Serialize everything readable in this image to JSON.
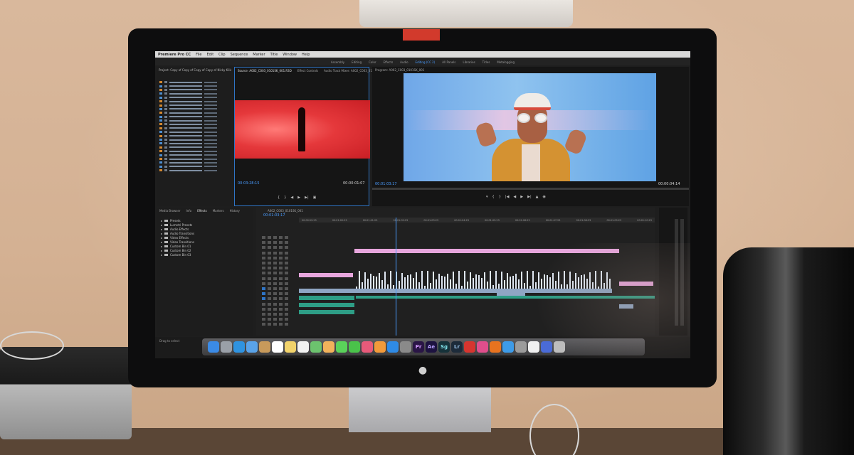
{
  "menubar": {
    "items": [
      "Premiere Pro CC",
      "File",
      "Edit",
      "Clip",
      "Sequence",
      "Marker",
      "Title",
      "Window",
      "Help"
    ]
  },
  "workspaces": {
    "items": [
      "Assembly",
      "Editing",
      "Color",
      "Effects",
      "Audio",
      "Editing (CC 2)",
      "All Panels",
      "Libraries",
      "Titles",
      "Metalogging"
    ],
    "active_index": 5
  },
  "project_panel": {
    "title": "Project: Copy of Copy of Copy of Copy of Nicky Kilian",
    "clip_count": 24
  },
  "source_panel": {
    "tabs": [
      "Source: A002_C003_0101SK_001.R3D",
      "Effect Controls",
      "Audio Track Mixer: A002_C003_0101SK_001"
    ],
    "timecode_in": "00:03:28:15",
    "timecode_out": "00:00:01:07"
  },
  "program_panel": {
    "tab": "Program: A002_C003_0101SK_001",
    "timecode_in": "00:01:03:17",
    "timecode_out": "00:00:04:14"
  },
  "effects_panel": {
    "tabs": [
      "Media Browser",
      "Info",
      "Effects",
      "Markers",
      "History"
    ],
    "items": [
      "Presets",
      "Lumetri Presets",
      "Audio Effects",
      "Audio Transitions",
      "Video Effects",
      "Video Transitions",
      "Custom Bin 01",
      "Custom Bin 02",
      "Custom Bin 03"
    ]
  },
  "timeline_panel": {
    "sequence_tab": "A002_C003_0101SK_001",
    "timecode": "00:01:03:17",
    "ruler_labels": [
      "00:00:59:23",
      "00:01:00:23",
      "00:01:01:23",
      "00:01:02:23",
      "00:01:03:23",
      "00:01:04:23",
      "00:01:05:23",
      "00:01:06:23",
      "00:01:07:23",
      "00:01:08:23",
      "00:01:09:23",
      "00:01:10:23"
    ]
  },
  "status": {
    "text": "Drag to select"
  },
  "dock": {
    "icons": [
      {
        "name": "finder-icon",
        "color": "#3b8be6",
        "glyph": ""
      },
      {
        "name": "launchpad-icon",
        "color": "#9aa0a8",
        "glyph": ""
      },
      {
        "name": "safari-icon",
        "color": "#2f93e0",
        "glyph": ""
      },
      {
        "name": "mail-icon",
        "color": "#5aa3e8",
        "glyph": ""
      },
      {
        "name": "contacts-icon",
        "color": "#c89a5b",
        "glyph": ""
      },
      {
        "name": "calendar-icon",
        "color": "#ffffff",
        "glyph": ""
      },
      {
        "name": "notes-icon",
        "color": "#f2d36b",
        "glyph": ""
      },
      {
        "name": "reminders-icon",
        "color": "#f2f2f2",
        "glyph": ""
      },
      {
        "name": "maps-icon",
        "color": "#6cc26e",
        "glyph": ""
      },
      {
        "name": "photos-icon",
        "color": "#f2b25b",
        "glyph": ""
      },
      {
        "name": "messages-icon",
        "color": "#5ad25a",
        "glyph": ""
      },
      {
        "name": "facetime-icon",
        "color": "#4ac34a",
        "glyph": ""
      },
      {
        "name": "music-icon",
        "color": "#e85a7a",
        "glyph": ""
      },
      {
        "name": "ibooks-icon",
        "color": "#f29a3a",
        "glyph": ""
      },
      {
        "name": "app-store-icon",
        "color": "#2f8be6",
        "glyph": ""
      },
      {
        "name": "preferences-icon",
        "color": "#8a8a8a",
        "glyph": ""
      },
      {
        "name": "premiere-icon",
        "color": "#2a1546",
        "glyph": "Pr"
      },
      {
        "name": "after-effects-icon",
        "color": "#1d1240",
        "glyph": "Ae"
      },
      {
        "name": "speedgrade-icon",
        "color": "#16323a",
        "glyph": "Sg"
      },
      {
        "name": "lightroom-icon",
        "color": "#1d2b3a",
        "glyph": "Lr"
      },
      {
        "name": "creative-cloud-icon",
        "color": "#d6352f",
        "glyph": ""
      },
      {
        "name": "itunes-icon",
        "color": "#e04e8c",
        "glyph": ""
      },
      {
        "name": "firefox-icon",
        "color": "#e8731f",
        "glyph": ""
      },
      {
        "name": "chrome-icon",
        "color": "#3d9be8",
        "glyph": ""
      },
      {
        "name": "utility-icon",
        "color": "#9b9b9b",
        "glyph": ""
      },
      {
        "name": "vlc-icon",
        "color": "#f0f0f0",
        "glyph": ""
      },
      {
        "name": "app-icon",
        "color": "#4a6bd6",
        "glyph": ""
      },
      {
        "name": "trash-icon",
        "color": "#bdbdbd",
        "glyph": ""
      }
    ]
  }
}
